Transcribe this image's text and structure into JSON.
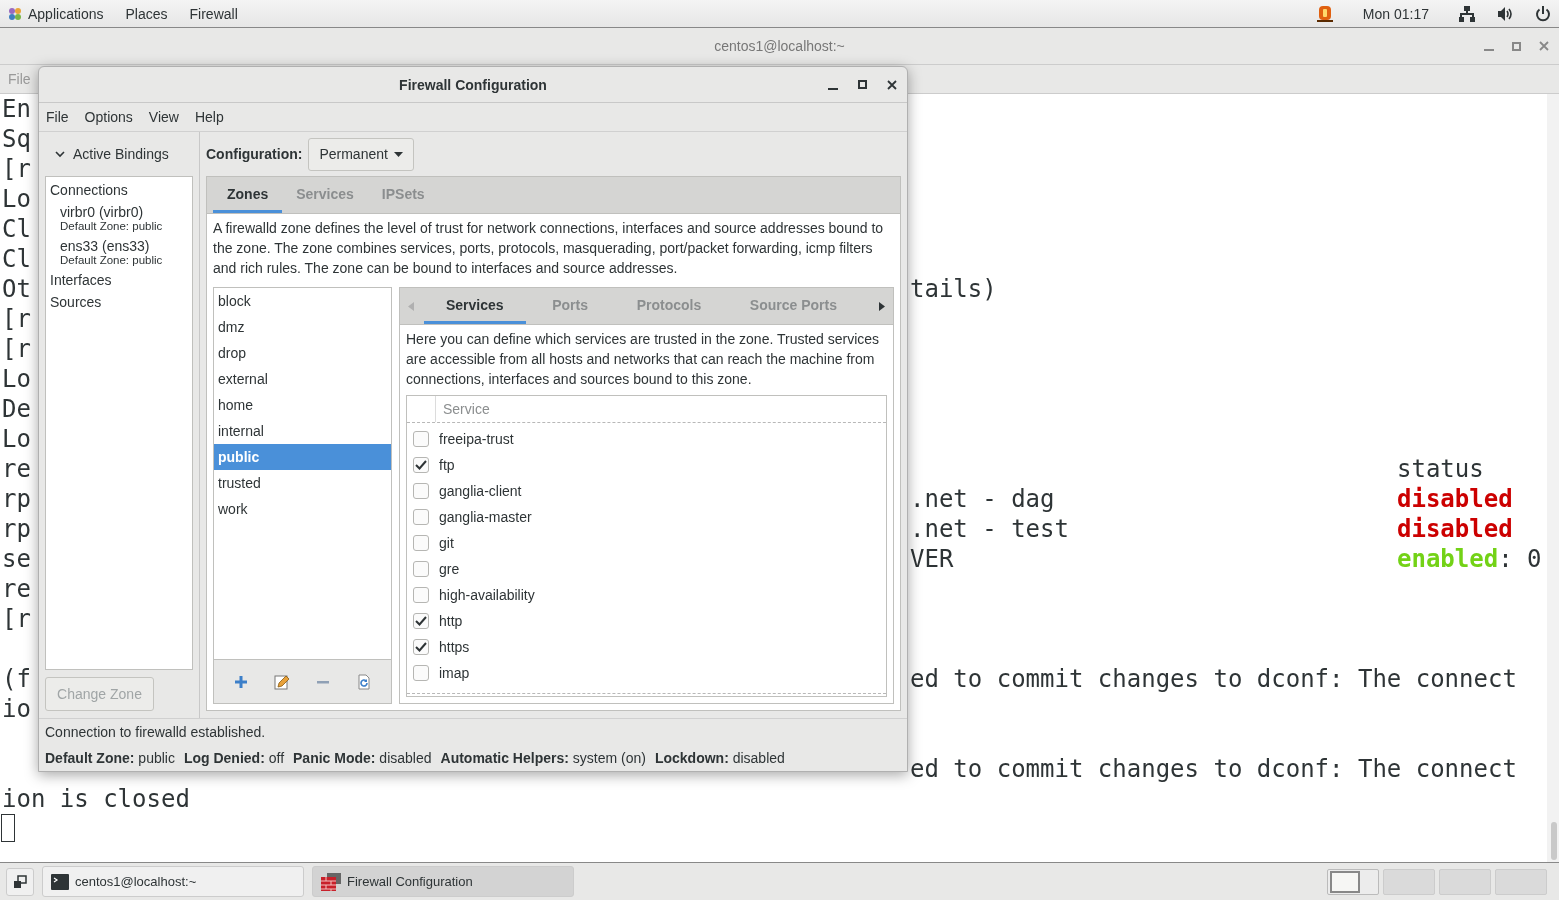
{
  "top_bar": {
    "menus": [
      "Applications",
      "Places",
      "Firewall"
    ],
    "clock": "Mon 01:17"
  },
  "terminal": {
    "title": "centos1@localhost:~",
    "menu": [
      "File"
    ],
    "blocks": [
      {
        "lines": [
          {
            "left": [
              {
                "text": "En"
              }
            ]
          },
          {
            "left": [
              {
                "text": "Sq"
              }
            ]
          },
          {
            "left": [
              {
                "text": "[r"
              }
            ]
          },
          {
            "left": [
              {
                "text": "Lo"
              }
            ]
          },
          {
            "left": [
              {
                "text": "Cl"
              }
            ]
          },
          {
            "left": [
              {
                "text": "Cl"
              }
            ]
          },
          {
            "left": [
              {
                "text": "Ot"
              }
            ],
            "middle": [
              {
                "text": "tails)"
              }
            ]
          },
          {
            "left": [
              {
                "text": "[r"
              }
            ]
          },
          {
            "left": [
              {
                "text": "[r"
              }
            ]
          },
          {
            "left": [
              {
                "text": "Lo"
              }
            ]
          },
          {
            "left": [
              {
                "text": "De"
              }
            ]
          },
          {
            "left": [
              {
                "text": "Lo"
              }
            ]
          },
          {
            "left": [
              {
                "text": "re"
              }
            ],
            "right": [
              {
                "text": "status"
              }
            ]
          },
          {
            "left": [
              {
                "text": "rp"
              }
            ],
            "middle": [
              {
                "text": ".net - dag"
              }
            ],
            "right": [
              {
                "text": "disabled",
                "color": "#cc0000"
              }
            ]
          },
          {
            "left": [
              {
                "text": "rp"
              }
            ],
            "middle": [
              {
                "text": ".net - test"
              }
            ],
            "right": [
              {
                "text": "disabled",
                "color": "#cc0000"
              }
            ]
          },
          {
            "left": [
              {
                "text": "se"
              }
            ],
            "middle": [
              {
                "text": "VER"
              }
            ],
            "right": [
              {
                "text": "enabled",
                "color": "#73d216"
              },
              {
                "text": ": 0"
              }
            ]
          },
          {
            "left": [
              {
                "text": "re"
              }
            ]
          },
          {
            "left": [
              {
                "text": "[r"
              }
            ]
          }
        ]
      },
      {
        "lines": [
          {
            "left": [
              {
                "text": "(f"
              }
            ],
            "middle": [
              {
                "text": "ed to commit changes to dconf: The connect"
              }
            ]
          },
          {
            "left": [
              {
                "text": "io"
              }
            ]
          }
        ]
      },
      {
        "lines": [
          {
            "middle": [
              {
                "text": "ed to commit changes to dconf: The connect"
              }
            ]
          },
          {
            "left": [
              {
                "text": "ion is closed"
              }
            ]
          }
        ]
      }
    ]
  },
  "dialog": {
    "title": "Firewall Configuration",
    "menu": [
      "File",
      "Options",
      "View",
      "Help"
    ],
    "bindings": {
      "label": "Active Bindings",
      "expanded": true,
      "items": [
        {
          "kind": "header",
          "label": "Connections"
        },
        {
          "kind": "connection",
          "label": "virbr0 (virbr0)",
          "detail": "Default Zone: public"
        },
        {
          "kind": "connection",
          "label": "ens33 (ens33)",
          "detail": "Default Zone: public"
        },
        {
          "kind": "header",
          "label": "Interfaces"
        },
        {
          "kind": "header",
          "label": "Sources"
        }
      ],
      "button": {
        "label": "Change Zone",
        "disabled": true
      }
    },
    "configuration": {
      "label": "Configuration:",
      "value": "Permanent"
    },
    "tabs": [
      {
        "label": "Zones",
        "selected": true
      },
      {
        "label": "Services",
        "selected": false
      },
      {
        "label": "IPSets",
        "selected": false
      }
    ],
    "description": "A firewalld zone defines the level of trust for network connections, interfaces and source addresses bound to the zone. The zone combines services, ports, protocols, masquerading, port/packet forwarding, icmp filters and rich rules. The zone can be bound to interfaces and source addresses.",
    "zones": [
      {
        "label": "block",
        "selected": false
      },
      {
        "label": "dmz",
        "selected": false
      },
      {
        "label": "drop",
        "selected": false
      },
      {
        "label": "external",
        "selected": false
      },
      {
        "label": "home",
        "selected": false
      },
      {
        "label": "internal",
        "selected": false
      },
      {
        "label": "public",
        "selected": true
      },
      {
        "label": "trusted",
        "selected": false
      },
      {
        "label": "work",
        "selected": false
      }
    ],
    "zone_tabs": [
      {
        "label": "Services",
        "selected": true
      },
      {
        "label": "Ports",
        "selected": false
      },
      {
        "label": "Protocols",
        "selected": false
      },
      {
        "label": "Source Ports",
        "selected": false
      }
    ],
    "zone_description": "Here you can define which services are trusted in the zone. Trusted services are accessible from all hosts and networks that can reach the machine from connections, interfaces and sources bound to this zone.",
    "services": {
      "column": "Service",
      "rows": [
        {
          "label": "freeipa-trust",
          "checked": false
        },
        {
          "label": "ftp",
          "checked": true
        },
        {
          "label": "ganglia-client",
          "checked": false
        },
        {
          "label": "ganglia-master",
          "checked": false
        },
        {
          "label": "git",
          "checked": false
        },
        {
          "label": "gre",
          "checked": false
        },
        {
          "label": "high-availability",
          "checked": false
        },
        {
          "label": "http",
          "checked": true
        },
        {
          "label": "https",
          "checked": true
        },
        {
          "label": "imap",
          "checked": false
        }
      ]
    },
    "status": "Connection to firewalld established.",
    "info": [
      "**Default Zone:** public",
      "**Log Denied:** off",
      "**Panic Mode:** disabled",
      "**Automatic Helpers:** system (on)",
      "**Lockdown:** disabled"
    ]
  },
  "taskbar": {
    "tasks": [
      {
        "kind": "terminal",
        "label": "centos1@localhost:~",
        "selected": false
      },
      {
        "kind": "firewall",
        "label": "Firewall Configuration",
        "selected": true
      }
    ],
    "workspaces": [
      {
        "selected": true
      },
      {
        "selected": false
      },
      {
        "selected": false
      },
      {
        "selected": false
      }
    ]
  }
}
